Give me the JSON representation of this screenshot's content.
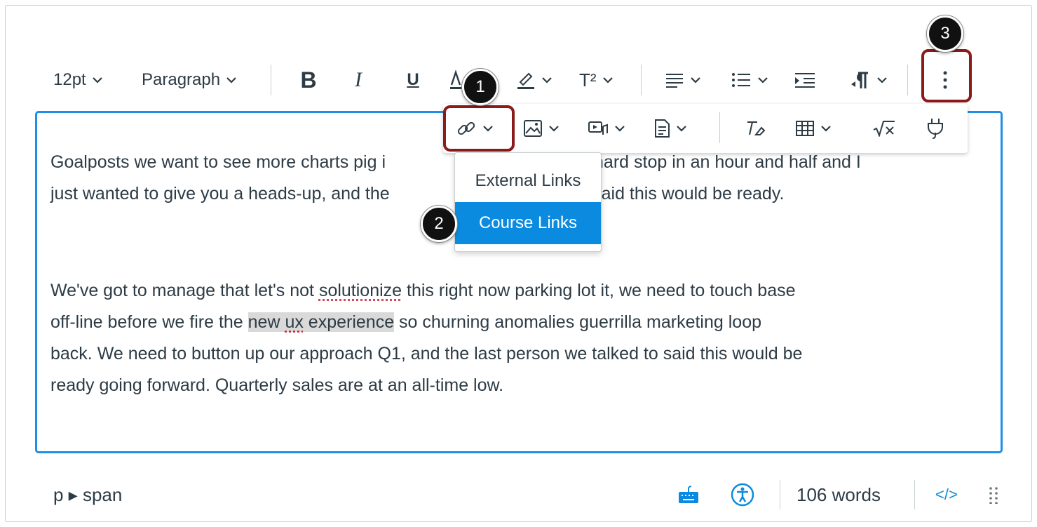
{
  "toolbar": {
    "font_size": "12pt",
    "block_format": "Paragraph",
    "bold": "B",
    "italic": "I",
    "underline": "U",
    "superscript": "T²"
  },
  "links_menu": {
    "items": [
      {
        "label": "External Links"
      },
      {
        "label": "Course Links"
      }
    ],
    "selected": "Course Links"
  },
  "content": {
    "para1_line1_a": "Goalposts we want to see more charts pig i",
    "para1_line1_b": "have a hard stop in an hour and half and I",
    "para1_line2_a": "just wanted to give you a heads-up, and the",
    "para1_line2_b": "talked to said this would be ready.",
    "para2_line1_a": "We've got to manage that let's not ",
    "para2_line1_spell": "solutionize",
    "para2_line1_b": " this right now parking lot it, we need to touch base",
    "para2_line2_a": "off-line before we fire the ",
    "para2_line2_hl_a": "new ",
    "para2_line2_hl_spell": "ux",
    "para2_line2_hl_b": " experience",
    "para2_line2_b": " so churning anomalies guerrilla marketing loop",
    "para2_line3": "back. We need to button up our approach Q1, and the last person we talked to said this would be",
    "para2_line4": "ready going forward. Quarterly sales are at an all-time low."
  },
  "status_bar": {
    "path": "p ▸ span",
    "word_count": "106 words",
    "html_toggle": "</>"
  },
  "callouts": [
    "1",
    "2",
    "3"
  ],
  "colors": {
    "accent": "#0b8be0",
    "editor_border": "#1e8fe6",
    "callout_box": "#8b1a1a"
  }
}
